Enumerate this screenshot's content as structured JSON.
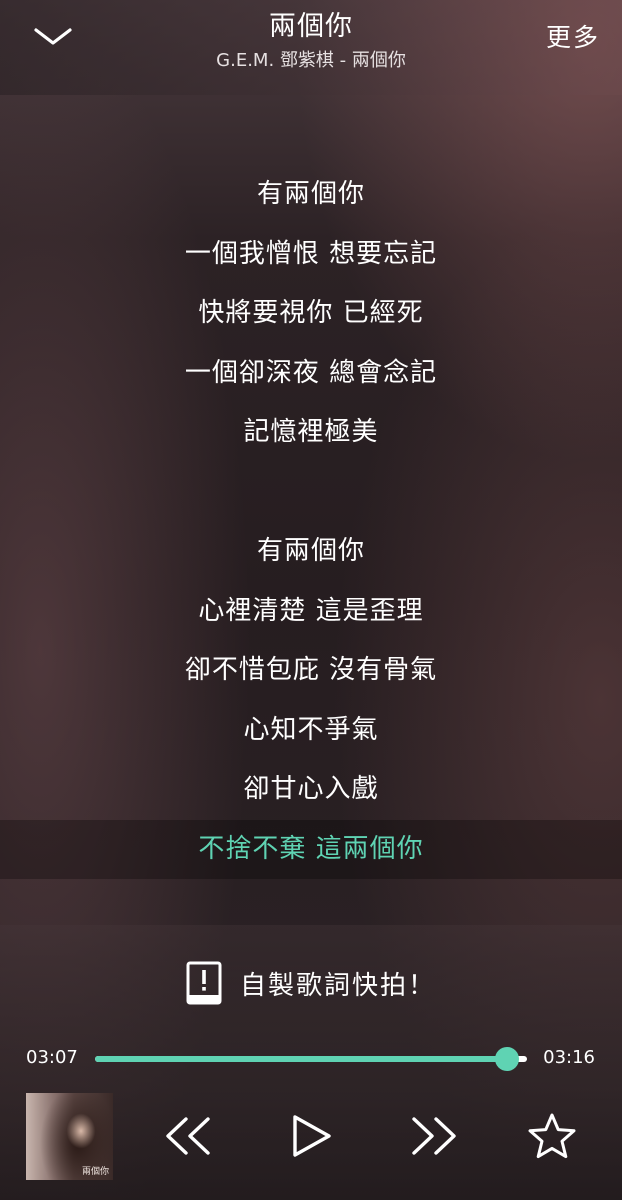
{
  "header": {
    "title": "兩個你",
    "subtitle": "G.E.M. 鄧紫棋 - 兩個你",
    "more_label": "更多",
    "collapse_icon": "chevron-down-icon"
  },
  "lyrics": {
    "lines": [
      "有兩個你",
      "一個我憎恨 想要忘記",
      "快將要視你 已經死",
      "一個卻深夜 總會念記",
      "記憶裡極美",
      "",
      "有兩個你",
      "心裡清楚 這是歪理",
      "卻不惜包庇 沒有骨氣",
      "心知不爭氣",
      "卻甘心入戲",
      "不捨不棄 這兩個你"
    ],
    "current_index": 11
  },
  "snapshot": {
    "label": "自製歌詞快拍！",
    "icon": "lyrics-card-icon"
  },
  "player": {
    "elapsed": "03:07",
    "total": "03:16",
    "progress_fraction": 0.954,
    "album_caption": "兩個你",
    "controls": {
      "previous_icon": "rewind-icon",
      "play_icon": "play-icon",
      "next_icon": "fast-forward-icon",
      "favorite_icon": "star-icon"
    }
  },
  "colors": {
    "accent": "#5fd3b3",
    "text": "#ffffff",
    "progress_track": "#ffffff"
  }
}
